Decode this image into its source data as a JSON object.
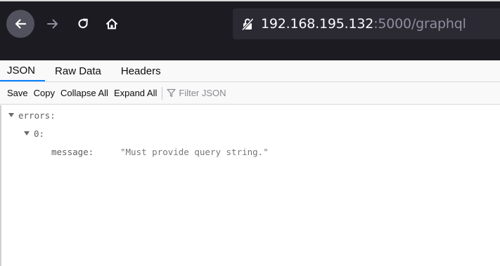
{
  "browser": {
    "url_host": "192.168.195.132",
    "url_rest": ":5000/graphql",
    "icons": {
      "back": "back-arrow-icon",
      "forward": "forward-arrow-icon",
      "reload": "reload-icon",
      "home": "home-icon",
      "lock": "insecure-lock-icon"
    }
  },
  "viewer": {
    "tabs": [
      {
        "label": "JSON"
      },
      {
        "label": "Raw Data"
      },
      {
        "label": "Headers"
      }
    ],
    "toolbar": {
      "save": "Save",
      "copy": "Copy",
      "collapse_all": "Collapse All",
      "expand_all": "Expand All",
      "filter_placeholder": "Filter JSON"
    }
  },
  "tree": {
    "root_key": "errors:",
    "item_key": "0:",
    "message_key": "message:",
    "message_value": "\"Must provide query string.\""
  }
}
